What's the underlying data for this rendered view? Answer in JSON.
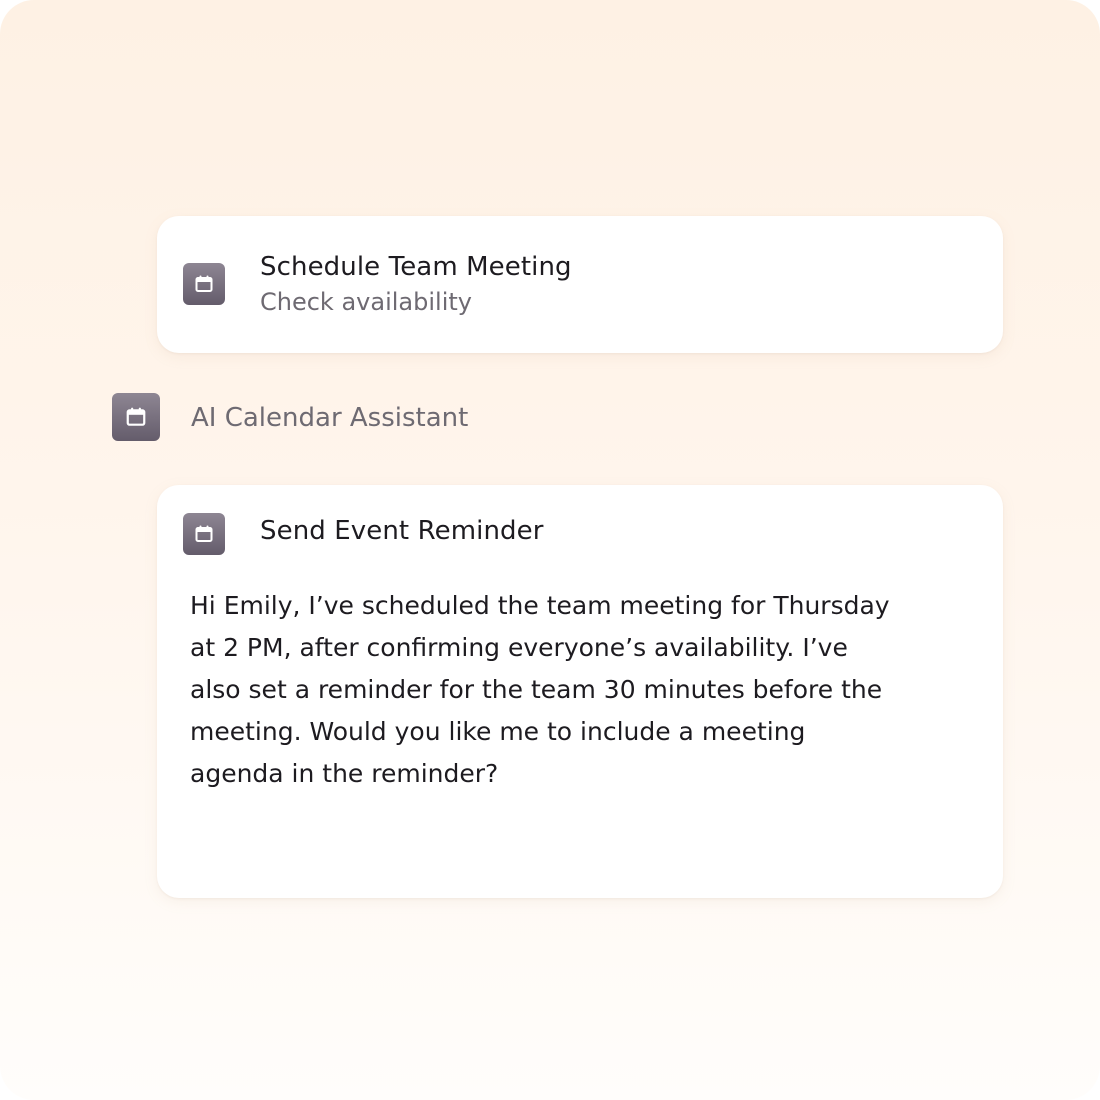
{
  "task_card": {
    "icon": "calendar-icon",
    "title": "Schedule Team Meeting",
    "subtitle": "Check availability"
  },
  "assistant": {
    "icon": "calendar-icon",
    "name": "AI Calendar Assistant"
  },
  "message_card": {
    "icon": "calendar-icon",
    "title": "Send Event Reminder",
    "body": "Hi Emily, I’ve scheduled the team meeting for Thursday at 2 PM, after confirming everyone’s availability. I’ve also set a reminder for the team 30 minutes before the meeting. Would you like me to include a meeting agenda in the reminder?"
  },
  "colors": {
    "background_top": "#fef1e4",
    "background_bottom": "#fffdfb",
    "icon_tile": "#7a7280",
    "text_primary": "#1d1b20",
    "text_secondary": "#6e6a72"
  }
}
